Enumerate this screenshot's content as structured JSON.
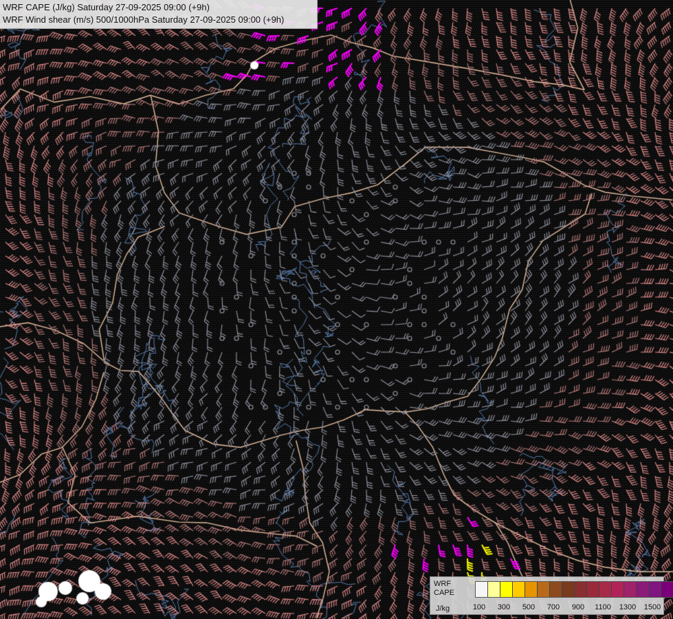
{
  "title": {
    "line1": "WRF CAPE (J/kg) Saturday 27-09-2025 09:00 (+9h)",
    "line2": "WRF Wind shear (m/s) 500/1000hPa Saturday 27-09-2025 09:00 (+9h)"
  },
  "legend": {
    "label_line1": "WRF",
    "label_line2": "CAPE",
    "unit": "J/kg",
    "colors": [
      "#f5f5f5",
      "#ffff99",
      "#ffff00",
      "#ffcc00",
      "#e69500",
      "#b86a1a",
      "#8c4a1e",
      "#7a3a1e",
      "#8a2f2f",
      "#9a2a3a",
      "#a82848",
      "#b22258",
      "#a0226a",
      "#8c1a78",
      "#801480",
      "#7a007a"
    ],
    "tick_labels": [
      "100",
      "300",
      "500",
      "700",
      "900",
      "1100",
      "1300",
      "1500"
    ]
  },
  "map": {
    "background_color": "#0a0a0a",
    "border_color": "#e8c0a0",
    "river_color": "#5a7fb0",
    "barb_colors": {
      "low": "#9a9aa8",
      "mid": "#c08080",
      "high": "#e89090",
      "extreme": "#ff00ff",
      "cape_high": "#ffff00"
    }
  }
}
